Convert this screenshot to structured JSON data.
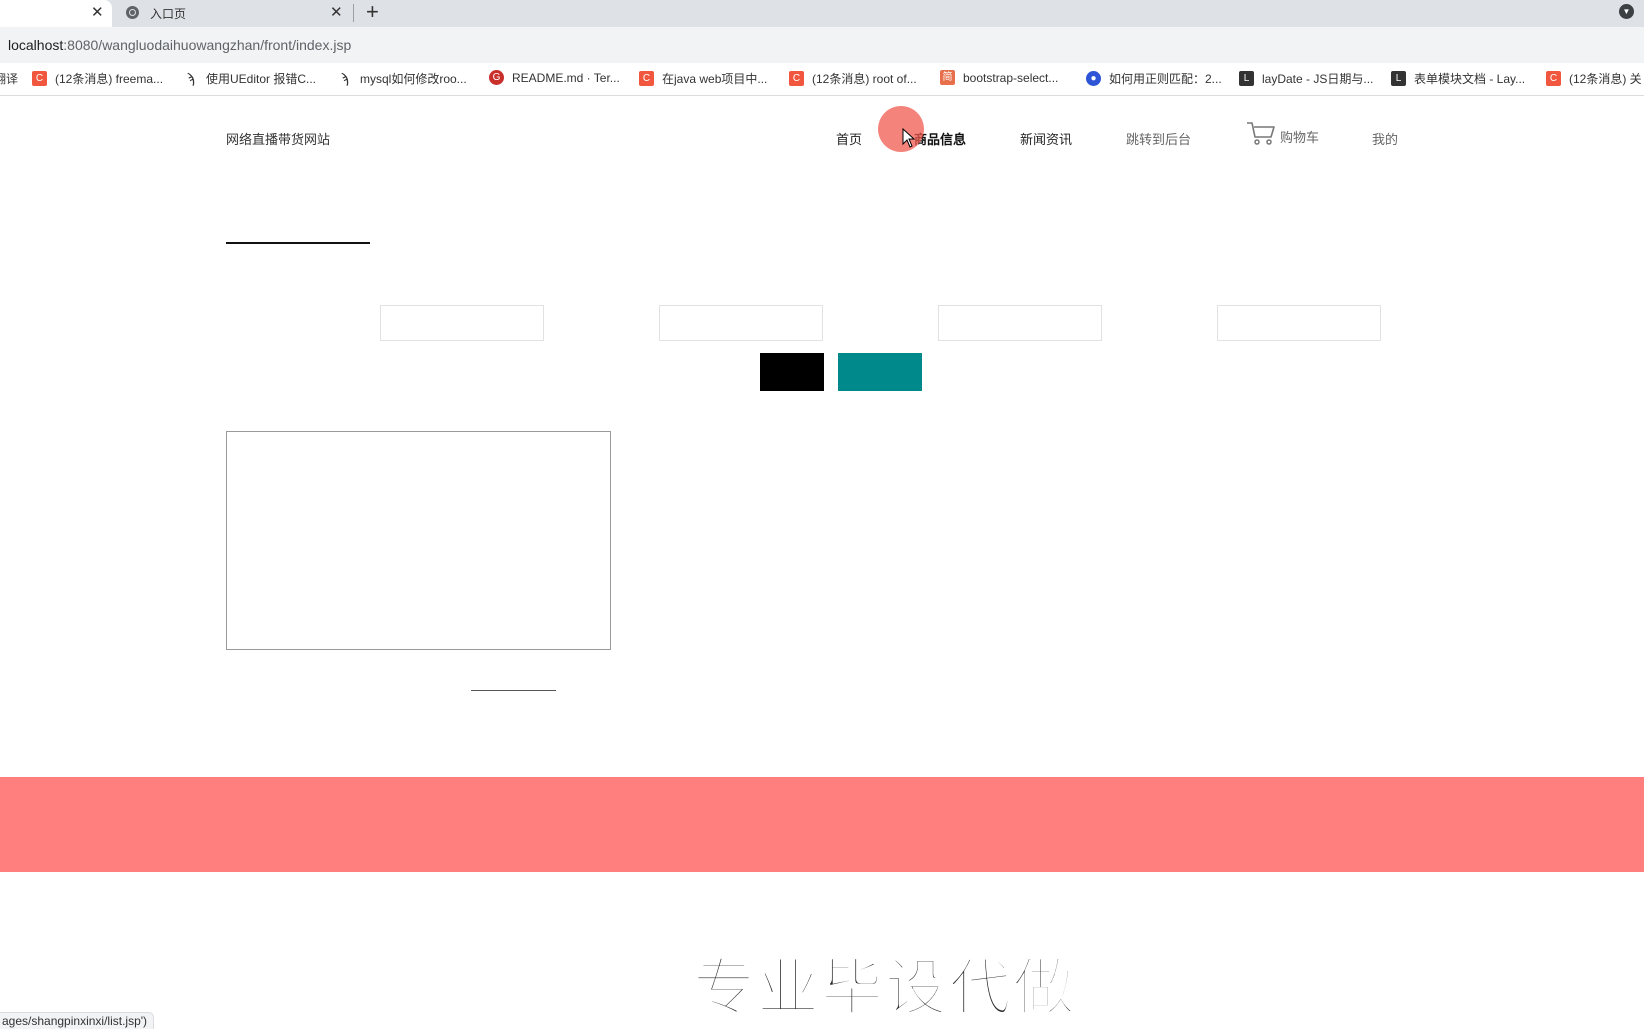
{
  "browser": {
    "tabs": [
      {
        "title": "",
        "active": true
      },
      {
        "title": "入口页",
        "active": false
      }
    ],
    "close_glyph": "✕",
    "new_tab_glyph": "+",
    "url_host": "localhost",
    "url_rest": ":8080/wangluodaihuowangzhan/front/index.jsp",
    "bookmarks": [
      {
        "label": "翻译",
        "icon": "none"
      },
      {
        "label": "(12条消息) freema...",
        "icon": "csdn-icon"
      },
      {
        "label": "使用UEditor 报错C...",
        "icon": "feather-icon"
      },
      {
        "label": "mysql如何修改roo...",
        "icon": "feather-icon"
      },
      {
        "label": "README.md · Ter...",
        "icon": "gitee-icon"
      },
      {
        "label": "在java web项目中...",
        "icon": "csdn-icon"
      },
      {
        "label": "(12条消息) root of...",
        "icon": "csdn-icon"
      },
      {
        "label": "bootstrap-select...",
        "icon": "jianshu-icon"
      },
      {
        "label": "如何用正则匹配：2...",
        "icon": "baidu-icon"
      },
      {
        "label": "layDate - JS日期与...",
        "icon": "layui-icon"
      },
      {
        "label": "表单模块文档 - Lay...",
        "icon": "layui-icon"
      },
      {
        "label": "(12条消息) 关",
        "icon": "csdn-icon"
      }
    ],
    "status_url": "ages/shangpinxinxi/list.jsp')"
  },
  "site": {
    "title": "网络直播带货网站",
    "nav": {
      "home": "首页",
      "products": "商品信息",
      "news": "新闻资讯",
      "admin": "跳转到后台",
      "cart": "购物车",
      "mine": "我的"
    },
    "filters": [
      {
        "value": "",
        "placeholder": ""
      },
      {
        "value": "",
        "placeholder": ""
      },
      {
        "value": "",
        "placeholder": ""
      },
      {
        "value": "",
        "placeholder": ""
      }
    ],
    "buttons": {
      "search": "",
      "add": ""
    },
    "colors": {
      "accent_teal": "#00898b",
      "footer_band": "#ff7f7f",
      "search_button": "#000000"
    }
  },
  "overlay": {
    "watermark": "专业毕设代做"
  }
}
